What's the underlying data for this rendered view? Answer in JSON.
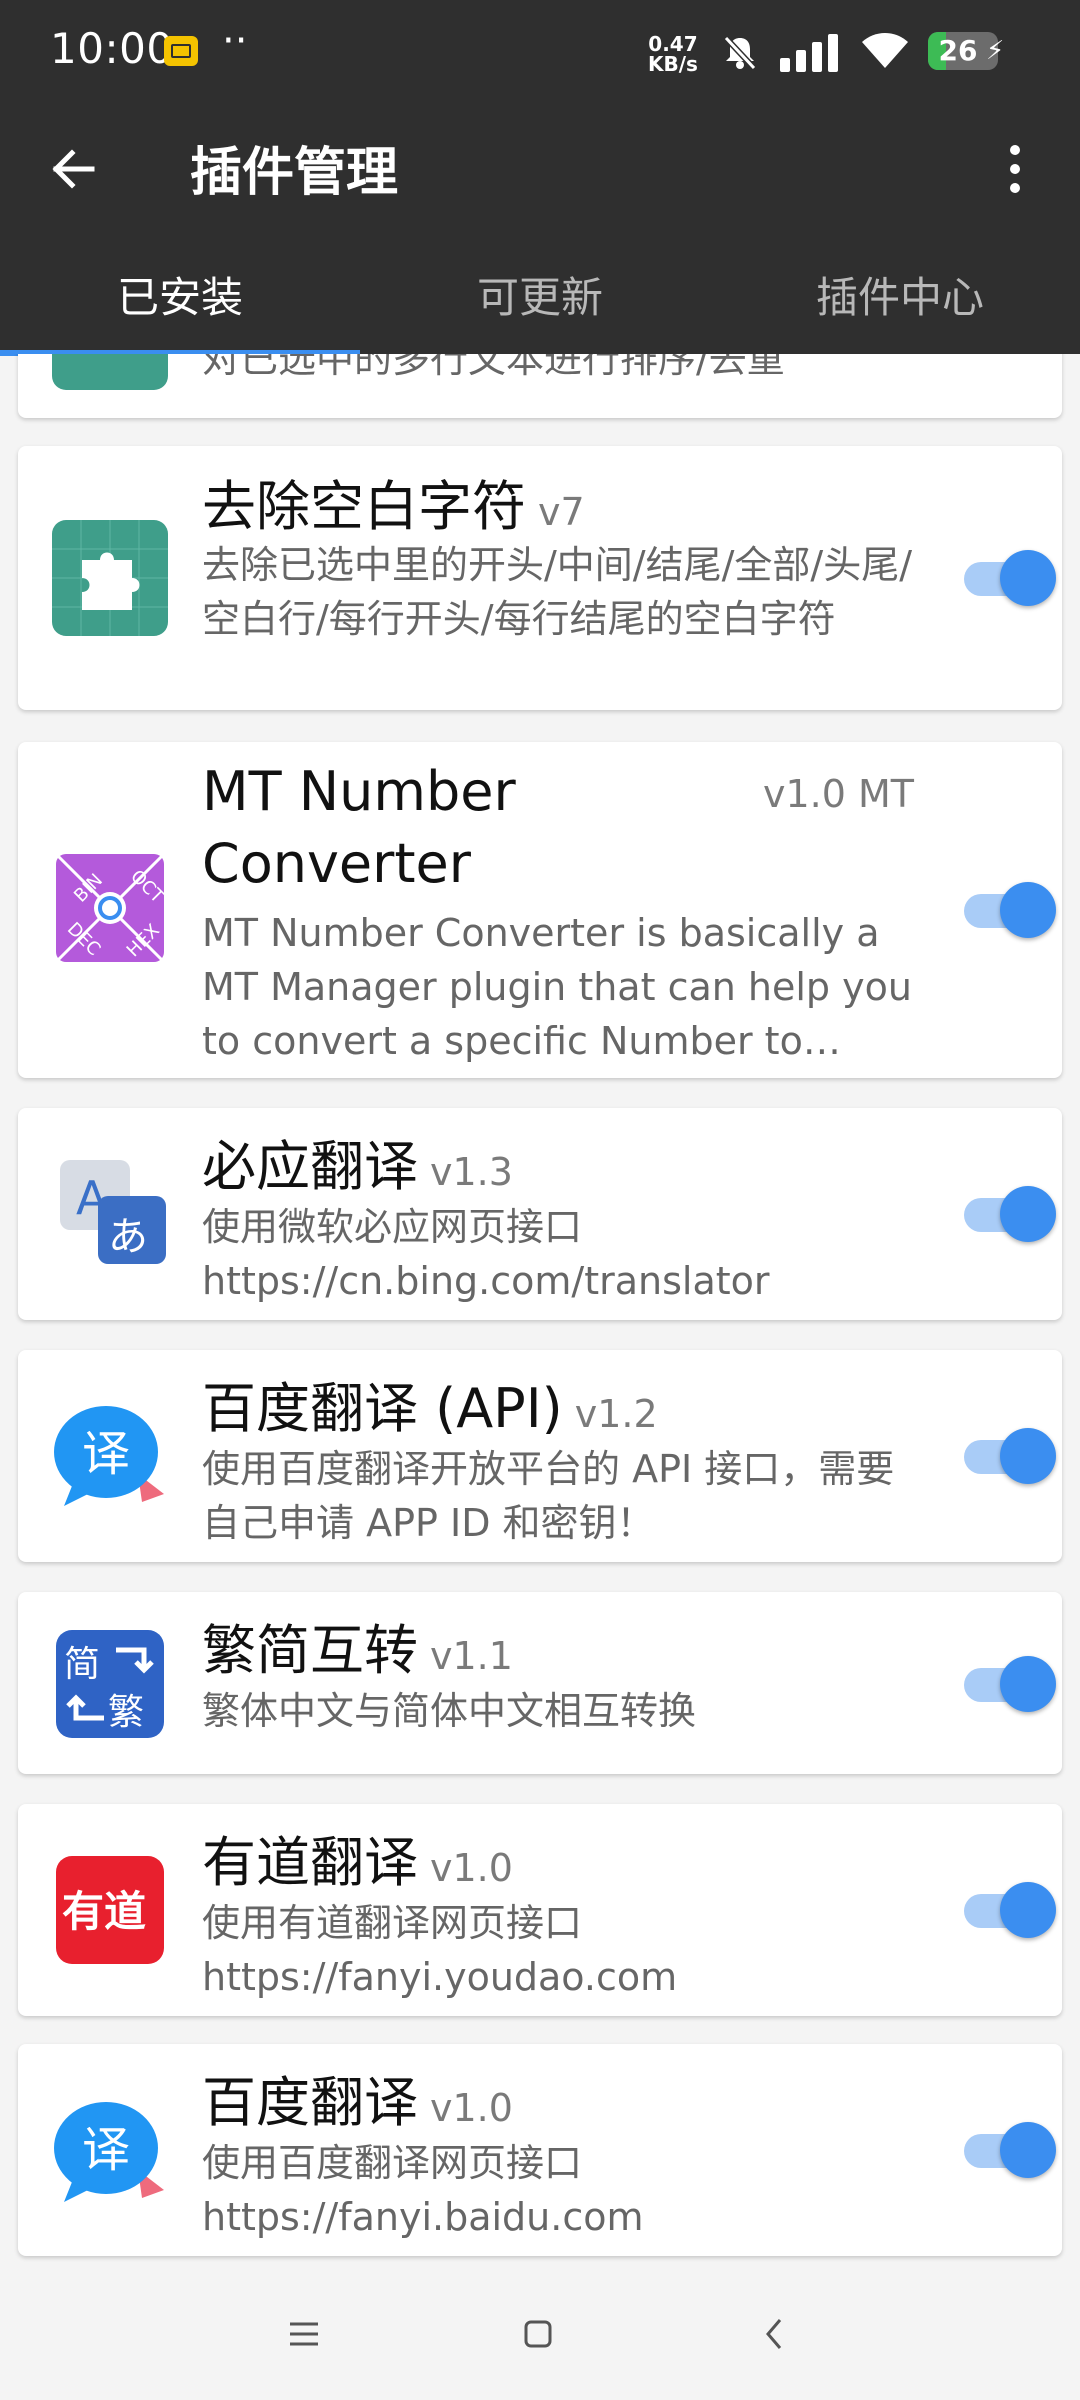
{
  "status": {
    "time": "10:00",
    "dots": "··",
    "net_speed_value": "0.47",
    "net_speed_unit": "KB/s",
    "battery": "26",
    "battery_level": 0.26,
    "colors": {
      "battery_fill": "#3dbb55",
      "sim": "#f4c300"
    }
  },
  "header": {
    "title": "插件管理",
    "back_icon": "arrow-left-icon",
    "menu_icon": "more-vertical-icon"
  },
  "tabs": [
    {
      "label": "已安装",
      "active": true
    },
    {
      "label": "可更新",
      "active": false
    },
    {
      "label": "插件中心",
      "active": false
    }
  ],
  "accent_color": "#3b8ef0",
  "plugins": [
    {
      "title": "",
      "version": "",
      "desc": "对已选中的多行文本进行排序/去重",
      "icon": "puzzle-icon",
      "enabled": true
    },
    {
      "title": "去除空白字符",
      "version": "v7",
      "desc": "去除已选中里的开头/中间/结尾/全部/头尾/空白行/每行开头/每行结尾的空白字符",
      "icon": "puzzle-icon",
      "enabled": true
    },
    {
      "title": "MT Number Converter",
      "version": "v1.0 MT",
      "desc": "MT Number Converter is basically a MT Manager plugin that can help you to convert a specific Number to…",
      "icon": "number-converter-icon",
      "icon_labels": [
        "BIN",
        "OCT",
        "DEC",
        "HEX"
      ],
      "enabled": true
    },
    {
      "title": "必应翻译",
      "version": "v1.3",
      "desc": "使用微软必应网页接口 https://cn.bing.com/translator",
      "icon": "translate-icon",
      "icon_labels": [
        "A",
        "あ"
      ],
      "enabled": true
    },
    {
      "title": "百度翻译 (API)",
      "version": "v1.2",
      "desc": "使用百度翻译开放平台的 API 接口，需要自己申请 APP ID 和密钥！",
      "icon": "baidu-translate-icon",
      "icon_labels": [
        "译"
      ],
      "enabled": true
    },
    {
      "title": "繁简互转",
      "version": "v1.1",
      "desc": "繁体中文与简体中文相互转换",
      "icon": "traditional-simplified-icon",
      "icon_labels": [
        "简",
        "繁"
      ],
      "enabled": true
    },
    {
      "title": "有道翻译",
      "version": "v1.0",
      "desc": "使用有道翻译网页接口 https://fanyi.youdao.com",
      "icon": "youdao-icon",
      "icon_labels": [
        "有道"
      ],
      "enabled": true
    },
    {
      "title": "百度翻译",
      "version": "v1.0",
      "desc": "使用百度翻译网页接口 https://fanyi.baidu.com",
      "icon": "baidu-translate-icon",
      "icon_labels": [
        "译"
      ],
      "enabled": true
    }
  ],
  "navbar": {
    "menu_icon": "menu-icon",
    "home_icon": "home-icon",
    "back_icon": "back-icon"
  }
}
